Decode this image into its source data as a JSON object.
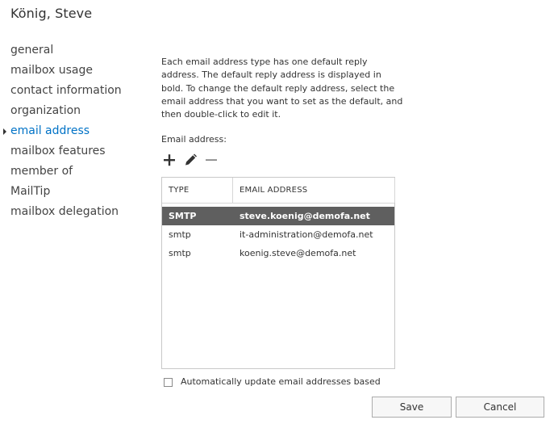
{
  "window": {
    "title": "König, Steve"
  },
  "nav": {
    "items": [
      {
        "label": "general"
      },
      {
        "label": "mailbox usage"
      },
      {
        "label": "contact information"
      },
      {
        "label": "organization"
      },
      {
        "label": "email address",
        "active": true
      },
      {
        "label": "mailbox features"
      },
      {
        "label": "member of"
      },
      {
        "label": "MailTip"
      },
      {
        "label": "mailbox delegation"
      }
    ],
    "active_color": "#0072c6"
  },
  "main": {
    "description": "Each email address type has one default reply address. The default reply address is displayed in bold. To change the default reply address, select the email address that you want to set as the default, and then double-click to edit it.",
    "email_label": "Email address:",
    "toolbar": {
      "add_icon": "plus-icon",
      "edit_icon": "pencil-icon",
      "remove_icon": "minus-icon"
    },
    "table": {
      "columns": [
        "TYPE",
        "EMAIL ADDRESS"
      ],
      "rows": [
        {
          "type": "SMTP",
          "email": "steve.koenig@demofa.net",
          "selected": true
        },
        {
          "type": "smtp",
          "email": "it-administration@demofa.net"
        },
        {
          "type": "smtp",
          "email": "koenig.steve@demofa.net"
        }
      ],
      "selected_row_color": "#5f5f5f"
    },
    "auto_update_label": "Automatically update email addresses based"
  },
  "footer": {
    "save_label": "Save",
    "cancel_label": "Cancel"
  }
}
